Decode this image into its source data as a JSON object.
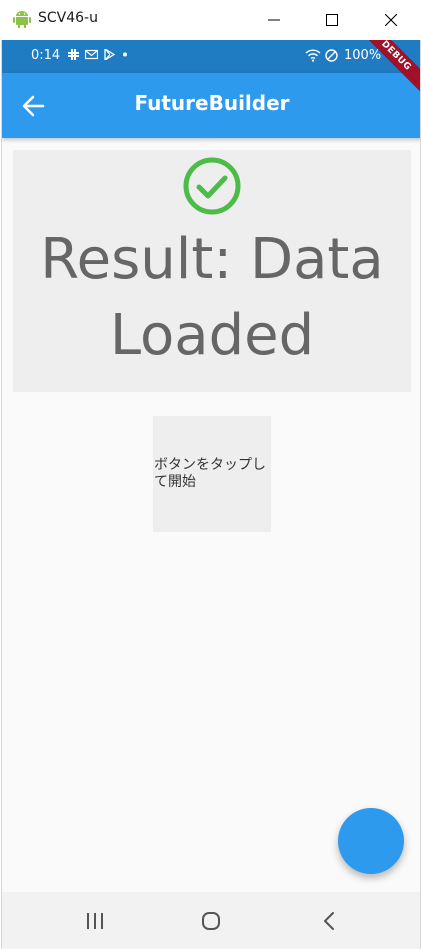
{
  "window": {
    "title": "SCV46-u"
  },
  "status_bar": {
    "time": "0:14",
    "battery": "100%"
  },
  "debug_banner": {
    "label": "DEBUG"
  },
  "app_bar": {
    "title": "FutureBuilder",
    "back_icon": "arrow-back-icon"
  },
  "result": {
    "icon": "check-circle-icon",
    "text": "Result: Data Loaded"
  },
  "start_button": {
    "label": "ボタンをタップして開始"
  },
  "colors": {
    "primary": "#2d9aed",
    "status_bar": "#1f7bc2",
    "success": "#4cbb48",
    "panel": "#eeeeee",
    "debug": "#a1112a"
  }
}
